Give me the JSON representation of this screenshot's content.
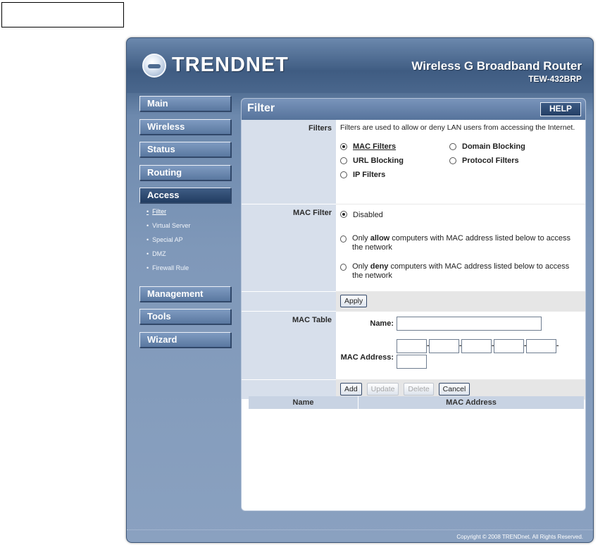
{
  "brand": {
    "logo_text": "TRENDNET",
    "product_name": "Wireless G Broadband Router",
    "model": "TEW-432BRP"
  },
  "nav": {
    "items": [
      {
        "id": "main",
        "label": "Main"
      },
      {
        "id": "wireless",
        "label": "Wireless"
      },
      {
        "id": "status",
        "label": "Status"
      },
      {
        "id": "routing",
        "label": "Routing"
      },
      {
        "id": "access",
        "label": "Access"
      }
    ],
    "access_sub": [
      "Filter",
      "Virtual Server",
      "Special AP",
      "DMZ",
      "Firewall Rule"
    ],
    "items_after": [
      {
        "id": "management",
        "label": "Management"
      },
      {
        "id": "tools",
        "label": "Tools"
      },
      {
        "id": "wizard",
        "label": "Wizard"
      }
    ]
  },
  "page": {
    "title": "Filter",
    "help": "HELP",
    "filters": {
      "label": "Filters",
      "desc": "Filters are used to allow or deny LAN users from accessing the Internet.",
      "options": [
        "MAC Filters",
        "Domain Blocking",
        "URL Blocking",
        "Protocol Filters",
        "IP Filters"
      ]
    },
    "mac_filter": {
      "label": "MAC Filter",
      "disabled": "Disabled",
      "allow_pre": "Only ",
      "allow_bold": "allow",
      "allow_post": " computers with MAC address listed below to access the network",
      "deny_pre": "Only ",
      "deny_bold": "deny",
      "deny_post": " computers with MAC address listed below to access the network"
    },
    "apply": "Apply",
    "mac_table": {
      "label": "MAC Table",
      "name_label": "Name:",
      "mac_label": "MAC Address:",
      "add": "Add",
      "update": "Update",
      "delete": "Delete",
      "cancel": "Cancel",
      "col_name": "Name",
      "col_mac": "MAC Address"
    }
  },
  "footer": "Copyright © 2008 TRENDnet. All Rights Reserved."
}
